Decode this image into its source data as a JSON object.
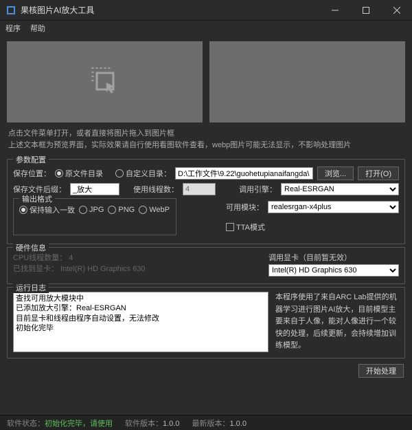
{
  "window": {
    "title": "果核图片AI放大工具",
    "min_tip": "最小化",
    "max_tip": "最大化",
    "close_tip": "关闭"
  },
  "menu": {
    "program": "程序",
    "help": "帮助"
  },
  "hints": {
    "line1": "点击文件菜单打开，或者直接将图片拖入到图片框",
    "line2": "上述文本框为预览界面，实际效果请自行使用看图软件查看，webp图片可能无法显示，不影响处理图片"
  },
  "params": {
    "legend": "参数配置",
    "save_loc_label": "保存位置：",
    "radio_same_dir": "原文件目录",
    "radio_custom_dir": "自定义目录：",
    "custom_dir_value": "D:\\工作文件\\9.22\\guohetupianaifangda\\",
    "browse_btn": "浏览...",
    "open_btn": "打开(O)",
    "suffix_label": "保存文件后缀：",
    "suffix_value": "_放大",
    "threads_label": "使用线程数：",
    "threads_value": "4",
    "engine_label": "调用引擎：",
    "engine_value": "Real-ESRGAN",
    "module_label": "可用模块：",
    "module_value": "realesrgan-x4plus",
    "output_fmt_legend": "输出格式",
    "fmt_keep": "保持输入一致",
    "fmt_jpg": "JPG",
    "fmt_png": "PNG",
    "fmt_webp": "WebP",
    "tta_label": "TTA模式"
  },
  "hw": {
    "legend": "硬件信息",
    "cpu_threads_label": "CPU线程数量：",
    "cpu_threads_value": "4",
    "gpu_found_label": "已找到显卡：",
    "gpu_found_value": "Intel(R) HD Graphics 630",
    "gpu_select_label": "调用显卡（目前暂无效）",
    "gpu_select_value": "Intel(R) HD Graphics 630"
  },
  "log": {
    "legend": "运行日志",
    "lines": "查找可用放大模块中\n已添加放大引擎：Real-ESRGAN\n目前显卡和线程由程序自动设置，无法修改\n初始化完毕",
    "desc": "本程序使用了来自ARC Lab提供的机器学习进行图片AI放大，目前模型主要来自于人像，能对人像进行一个较快的处理，后续更新，会持续增加训练模型。"
  },
  "action": {
    "start_btn": "开始处理"
  },
  "status": {
    "state_label": "软件状态：",
    "state_value": "初始化完毕，请使用",
    "ver_label": "软件版本：",
    "ver_value": "1.0.0",
    "latest_label": "最新版本：",
    "latest_value": "1.0.0"
  }
}
